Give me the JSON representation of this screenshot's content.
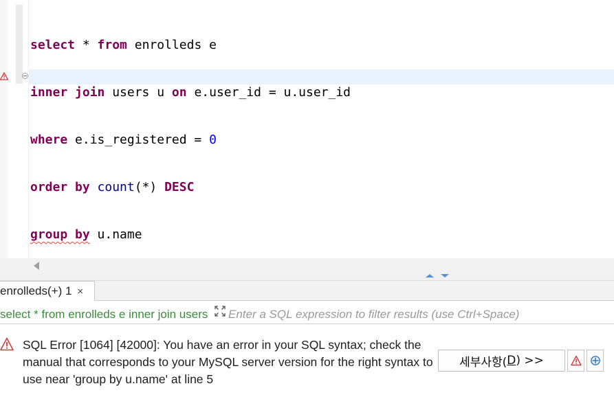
{
  "editor": {
    "line1": {
      "kw1": "select",
      "rest1": " * ",
      "kw2": "from",
      "rest2": " enrolleds e"
    },
    "line2": {
      "kw1": "inner join",
      "rest1": " users u ",
      "kw2": "on",
      "rest2": " e.user_id = u.user_id"
    },
    "line3": {
      "kw1": "where",
      "rest1": " e.is_registered = ",
      "num": "0"
    },
    "line4": {
      "kw1": "order by",
      "space": " ",
      "fn": "count",
      "rest1": "(*) ",
      "kw2": "DESC"
    },
    "line5": {
      "kw1": "group by",
      "rest1": " u.name"
    }
  },
  "results": {
    "tab_label": "enrolleds(+) 1",
    "tab_close": "×",
    "query_preview": "select * from enrolleds e inner join users u on e.user_id = u.user_id",
    "filter_placeholder": "Enter a SQL expression to filter results (use Ctrl+Space)"
  },
  "error": {
    "message": "SQL Error [1064] [42000]: You have an error in your SQL syntax; check the manual that corresponds to your MySQL server version for the right syntax to use near 'group by u.name' at line 5",
    "details_label": "세부사항(",
    "details_mnemonic": "D",
    "details_suffix": ") >>"
  },
  "colors": {
    "keyword": "#7f0055",
    "function": "#000080",
    "number": "#0000ff",
    "query_preview": "#3c8c3c",
    "error_red": "#d23b3b",
    "current_line": "#e8f2fe"
  },
  "icons": [
    "error-marker-icon",
    "fold-toggle-icon",
    "scroll-left-icon",
    "maximize-panel-icon",
    "restore-panel-icon",
    "close-tab-icon",
    "expand-query-icon",
    "warning-icon",
    "error-log-icon",
    "target-icon"
  ]
}
